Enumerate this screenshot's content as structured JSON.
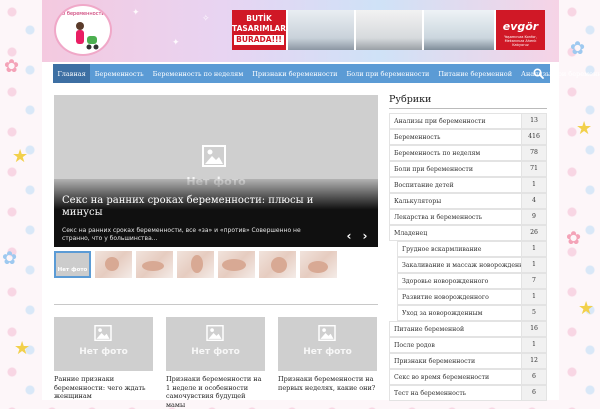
{
  "colors": {
    "nav": "#5b9bd5",
    "nav_active": "#3d6fa3",
    "placeholder": "#cfcfcf",
    "ad_red": "#d01826"
  },
  "header": {
    "logo_text": "О беременности",
    "ad": {
      "promo_lines": [
        "BUTİK",
        "TASARIMLAR"
      ],
      "promo_tag": "BURADA!!!",
      "brand": "evgör",
      "brand_slogan": "Yaşamınıza Konfor, Mekanınıza Ahenk Katıyoruz"
    }
  },
  "nav": {
    "items": [
      {
        "label": "Главная",
        "active": true
      },
      {
        "label": "Беременность"
      },
      {
        "label": "Беременность по неделям"
      },
      {
        "label": "Признаки беременности"
      },
      {
        "label": "Боли при беременности"
      },
      {
        "label": "Питание беременной"
      },
      {
        "label": "Анализы при беременности"
      }
    ],
    "search_icon": "search-icon"
  },
  "slider": {
    "no_photo": "Нет фото",
    "title": "Секс на ранних сроках беременности: плюсы и минусы",
    "excerpt": "Секс на ранних сроках беременности, все «за» и «против» Совершенно не странно, что у большинства...",
    "prev_icon": "chevron-left-icon",
    "next_icon": "chevron-right-icon"
  },
  "thumbnails": [
    {
      "kind": "nofoto",
      "label": "Нет фото"
    },
    {
      "kind": "photo"
    },
    {
      "kind": "photo"
    },
    {
      "kind": "photo"
    },
    {
      "kind": "photo"
    },
    {
      "kind": "photo"
    },
    {
      "kind": "photo"
    }
  ],
  "cards": [
    {
      "no_photo": "Нет фото",
      "title": "Ранние признаки беременности: чего ждать женщинам"
    },
    {
      "no_photo": "Нет фото",
      "title": "Признаки беременности на 1 неделе и особенности самочувствия будущей мамы"
    },
    {
      "no_photo": "Нет фото",
      "title": "Признаки беременности на первых неделях, какие они?"
    }
  ],
  "sidebar": {
    "title": "Рубрики",
    "categories": [
      {
        "label": "Анализы при беременности",
        "count": "13"
      },
      {
        "label": "Беременность",
        "count": "416"
      },
      {
        "label": "Беременность по неделям",
        "count": "78"
      },
      {
        "label": "Боли при беременности",
        "count": "71"
      },
      {
        "label": "Воспитание детей",
        "count": "1"
      },
      {
        "label": "Калькуляторы",
        "count": "4"
      },
      {
        "label": "Лекарства и беременность",
        "count": "9"
      },
      {
        "label": "Младенец",
        "count": "26"
      },
      {
        "label": "Грудное вскармливание",
        "count": "1",
        "sub": true
      },
      {
        "label": "Закаливание и массаж новорожденного",
        "count": "1",
        "sub": true
      },
      {
        "label": "Здоровье новорожденного",
        "count": "7",
        "sub": true
      },
      {
        "label": "Развитие новорожденного",
        "count": "1",
        "sub": true
      },
      {
        "label": "Уход за новорожденным",
        "count": "5",
        "sub": true
      },
      {
        "label": "Питание беременной",
        "count": "16"
      },
      {
        "label": "После родов",
        "count": "1"
      },
      {
        "label": "Признаки беременности",
        "count": "12"
      },
      {
        "label": "Секс во время беременности",
        "count": "6"
      },
      {
        "label": "Тест на беременность",
        "count": "6"
      }
    ]
  }
}
